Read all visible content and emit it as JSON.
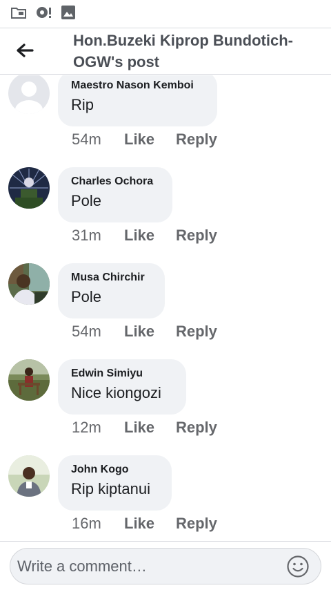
{
  "header": {
    "title": "Hon.Buzeki Kiprop Bundotich-OGW's post"
  },
  "comments": [
    {
      "author": "Maestro Nason Kemboi",
      "text": "Rip",
      "time": "54m",
      "like_label": "Like",
      "reply_label": "Reply"
    },
    {
      "author": "Charles Ochora",
      "text": "Pole",
      "time": "31m",
      "like_label": "Like",
      "reply_label": "Reply"
    },
    {
      "author": "Musa Chirchir",
      "text": "Pole",
      "time": "54m",
      "like_label": "Like",
      "reply_label": "Reply"
    },
    {
      "author": "Edwin Simiyu",
      "text": "Nice kiongozi",
      "time": "12m",
      "like_label": "Like",
      "reply_label": "Reply"
    },
    {
      "author": "John Kogo",
      "text": "Rip kiptanui",
      "time": "16m",
      "like_label": "Like",
      "reply_label": "Reply"
    }
  ],
  "composer": {
    "placeholder": "Write a comment…"
  },
  "icons": {
    "status": [
      "folder-icon",
      "sync-alert-icon",
      "image-icon"
    ],
    "back": "back-arrow-icon",
    "emoji": "emoji-icon"
  },
  "colors": {
    "bubble": "#f0f2f5",
    "meta": "#65676b",
    "title": "#4b4f56"
  }
}
